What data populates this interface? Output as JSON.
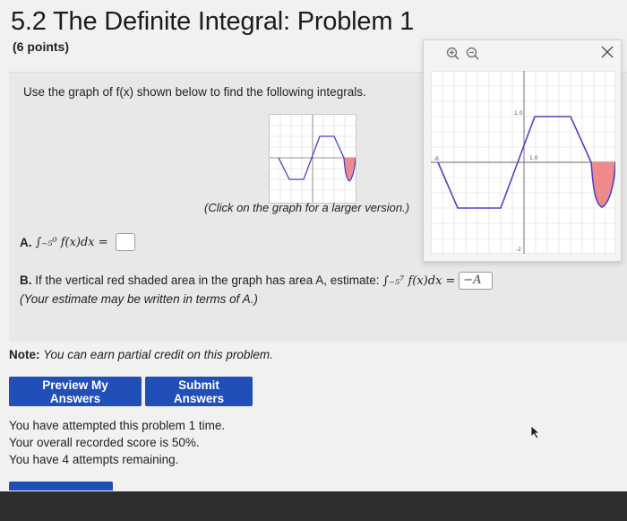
{
  "header": {
    "title": "5.2 The Definite Integral: Problem 1",
    "points": "(6 points)"
  },
  "problem": {
    "instruction": "Use the graph of f(x) shown below to find the following integrals.",
    "click_note": "(Click on the graph for a larger version.)",
    "partA": {
      "label": "A.",
      "expression": "∫₋₅⁰ f(x)dx =",
      "answer": ""
    },
    "partB": {
      "label": "B.",
      "text": "If the vertical red shaded area in the graph has area A, estimate:",
      "expression": "∫₋₅⁷ f(x)dx =",
      "answer": "−A",
      "hint": "(Your estimate may be written in terms of A.)"
    }
  },
  "note": {
    "label": "Note:",
    "text": "You can earn partial credit on this problem."
  },
  "buttons": {
    "preview": "Preview My Answers",
    "submit": "Submit Answers"
  },
  "status": {
    "line1": "You have attempted this problem 1 time.",
    "line2": "Your overall recorded score is 50%.",
    "line3": "You have 4 attempts remaining."
  },
  "popup": {
    "tick_y": "1.0",
    "tick_x": "1.0",
    "label_left": "-6",
    "label_bottom": "-2",
    "graph_color": "#4a44c8",
    "shade_color": "#f08a8a"
  },
  "colors": {
    "button": "#1f4fb7",
    "background": "#f1f1ef",
    "panel": "#e8e8e6"
  }
}
